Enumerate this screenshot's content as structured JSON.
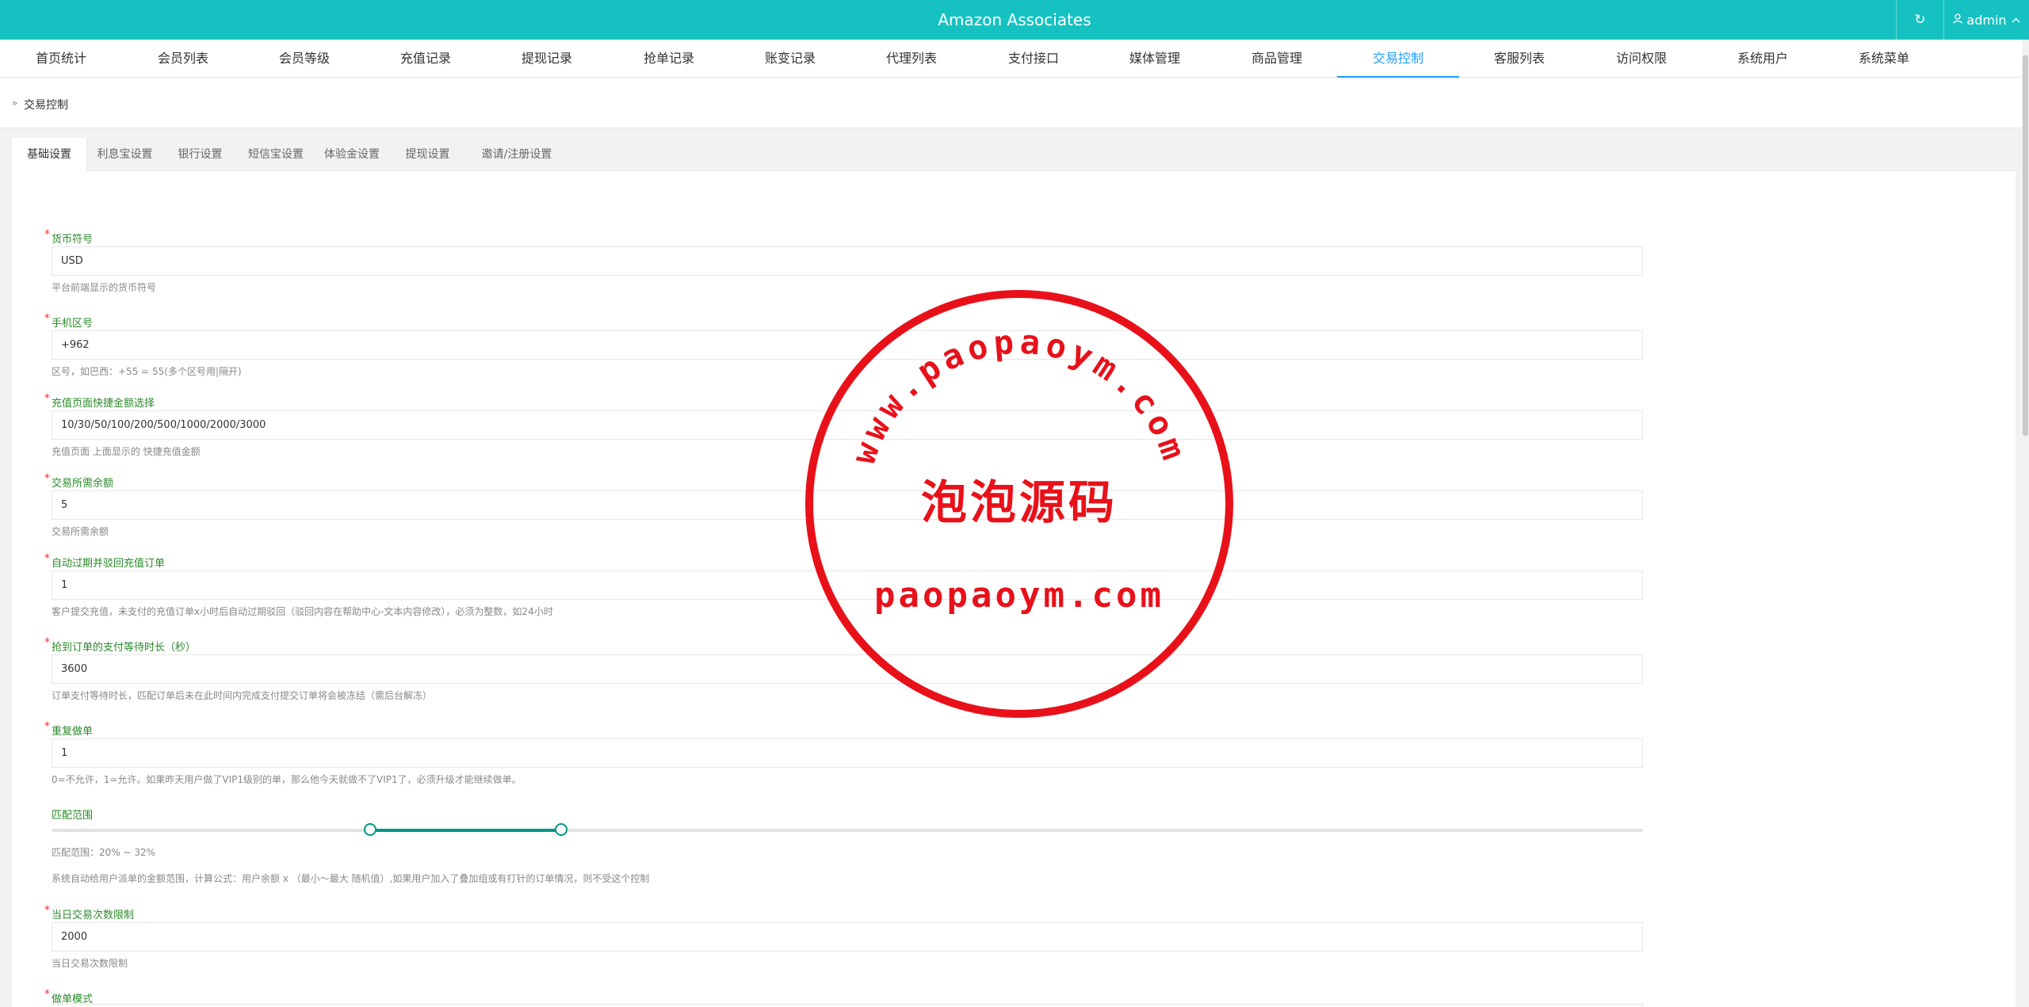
{
  "header": {
    "title": "Amazon Associates",
    "refresh_icon": "↻",
    "user_label": "admin"
  },
  "nav": [
    {
      "label": "首页统计"
    },
    {
      "label": "会员列表"
    },
    {
      "label": "会员等级"
    },
    {
      "label": "充值记录"
    },
    {
      "label": "提现记录"
    },
    {
      "label": "抢单记录"
    },
    {
      "label": "账变记录"
    },
    {
      "label": "代理列表"
    },
    {
      "label": "支付接口"
    },
    {
      "label": "媒体管理"
    },
    {
      "label": "商品管理"
    },
    {
      "label": "交易控制",
      "active": true
    },
    {
      "label": "客服列表"
    },
    {
      "label": "访问权限"
    },
    {
      "label": "系统用户"
    },
    {
      "label": "系统菜单"
    }
  ],
  "breadcrumb": {
    "arrow": "»",
    "current": "交易控制"
  },
  "tabs": [
    {
      "label": "基础设置",
      "active": true
    },
    {
      "label": "利息宝设置"
    },
    {
      "label": "银行设置"
    },
    {
      "label": "短信宝设置"
    },
    {
      "label": "体验金设置"
    },
    {
      "label": "提现设置"
    },
    {
      "label": "邀请/注册设置"
    }
  ],
  "form": {
    "currency": {
      "label": "货币符号",
      "value": "USD",
      "help": "平台前端显示的货币符号"
    },
    "phone_code": {
      "label": "手机区号",
      "value": "+962",
      "help": "区号，如巴西：+55 = 55(多个区号用|隔开)"
    },
    "quick_amounts": {
      "label": "充值页面快捷金额选择",
      "value": "10/30/50/100/200/500/1000/2000/3000",
      "help": "充值页面 上面显示的 快捷充值金额"
    },
    "min_balance": {
      "label": "交易所需余额",
      "value": "5",
      "help": "交易所需余额"
    },
    "auto_expire": {
      "label": "自动过期并驳回充值订单",
      "value": "1",
      "help": "客户提交充值，未支付的充值订单x小时后自动过期驳回（驳回内容在帮助中心-文本内容修改），必须为整数，如24小时"
    },
    "pay_wait": {
      "label": "抢到订单的支付等待时长（秒）",
      "value": "3600",
      "help": "订单支付等待时长，匹配订单后未在此时间内完成支付提交订单将会被冻结（需后台解冻）"
    },
    "repeat": {
      "label": "重复做单",
      "value": "1",
      "help": "0=不允许，1=允许。如果昨天用户做了VIP1级别的单，那么他今天就做不了VIP1了，必须升级才能继续做单。"
    },
    "match_range": {
      "label": "匹配范围",
      "min_percent": 20,
      "max_percent": 32,
      "value_text": "匹配范围：20% ~ 32%",
      "help": "系统自动给用户派单的金额范围，计算公式：用户余额 x （最小～最大 随机值）,如果用户加入了叠加组或有打针的订单情况，则不受这个控制"
    },
    "daily_limit": {
      "label": "当日交易次数限制",
      "value": "2000",
      "help": "当日交易次数限制"
    },
    "mode": {
      "label": "做单模式"
    }
  },
  "watermark": {
    "ring_text": "www.paopaoym.com",
    "center_text": "泡泡源码",
    "bottom_text": "paopaoym.com",
    "color": "#e8111a"
  },
  "colors": {
    "topbar": "#16c2c1",
    "nav_active": "#1e9fff",
    "label_green": "#2a8a2a",
    "slider": "#009688"
  }
}
